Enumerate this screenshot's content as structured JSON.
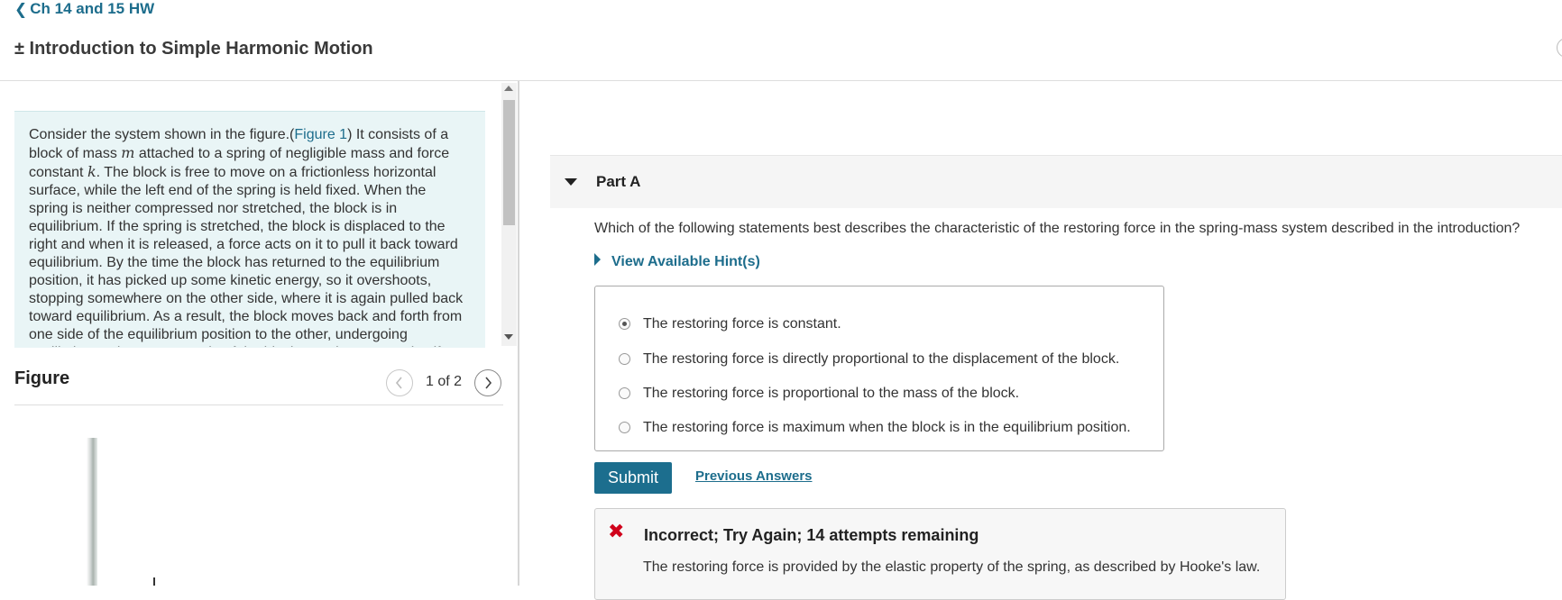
{
  "header": {
    "back_label": "Ch 14 and 15 HW",
    "back_icon": "chevron-left-icon",
    "title": "± Introduction to Simple Harmonic Motion"
  },
  "intro": {
    "lines": [
      {
        "before": "Consider the system shown in the figure.(",
        "link": "Figure 1",
        "after": ") It consists of a"
      },
      {
        "before": "block of mass ",
        "var": "m",
        "after": " attached to a spring of negligible mass and force"
      },
      {
        "before": "constant ",
        "var": "k",
        "after": ". The block is free to move on a frictionless horizontal"
      },
      {
        "before": "surface, while the left end of the spring is held fixed. When the"
      },
      {
        "before": "spring is neither compressed nor stretched, the block is in"
      },
      {
        "before": "equilibrium. If the spring is stretched, the block is displaced to the"
      },
      {
        "before": "right and when it is released, a force acts on it to pull it back toward"
      },
      {
        "before": "equilibrium. By the time the block has returned to the equilibrium"
      },
      {
        "before": "position, it has picked up some kinetic energy, so it overshoots,"
      },
      {
        "before": "stopping somewhere on the other side, where it is again pulled back"
      },
      {
        "before": "toward equilibrium. As a result, the block moves back and forth from"
      },
      {
        "before": "one side of the equilibrium position to the other, undergoing"
      },
      {
        "before": "oscillations. Since every cycle of the block's motion repeats itself"
      }
    ]
  },
  "figure": {
    "label": "Figure",
    "counter": "1 of 2",
    "prev_icon": "chevron-left-icon",
    "next_icon": "chevron-right-icon"
  },
  "partA": {
    "title": "Part A",
    "question": "Which of the following statements best describes the characteristic of the restoring force in the spring-mass system described in the introduction?",
    "hint_label": "View Available Hint(s)",
    "options": [
      {
        "label": "The restoring force is constant.",
        "selected": true
      },
      {
        "label": "The restoring force is directly proportional to the displacement of the block.",
        "selected": false
      },
      {
        "label": "The restoring force is proportional to the mass of the block.",
        "selected": false
      },
      {
        "label": "The restoring force is maximum when the block is in the equilibrium position.",
        "selected": false
      }
    ],
    "submit_label": "Submit",
    "previous_answers_label": "Previous Answers"
  },
  "feedback": {
    "icon": "x-icon",
    "icon_glyph": "✖",
    "title": "Incorrect; Try Again; 14 attempts remaining",
    "text": "The restoring force is provided by the elastic property of the spring, as described by Hooke's law.",
    "error_color": "#d0021b"
  },
  "colors": {
    "accent": "#1d6d8c",
    "submit_bg": "#1c6e8e",
    "intro_bg": "#e9f5f6"
  }
}
